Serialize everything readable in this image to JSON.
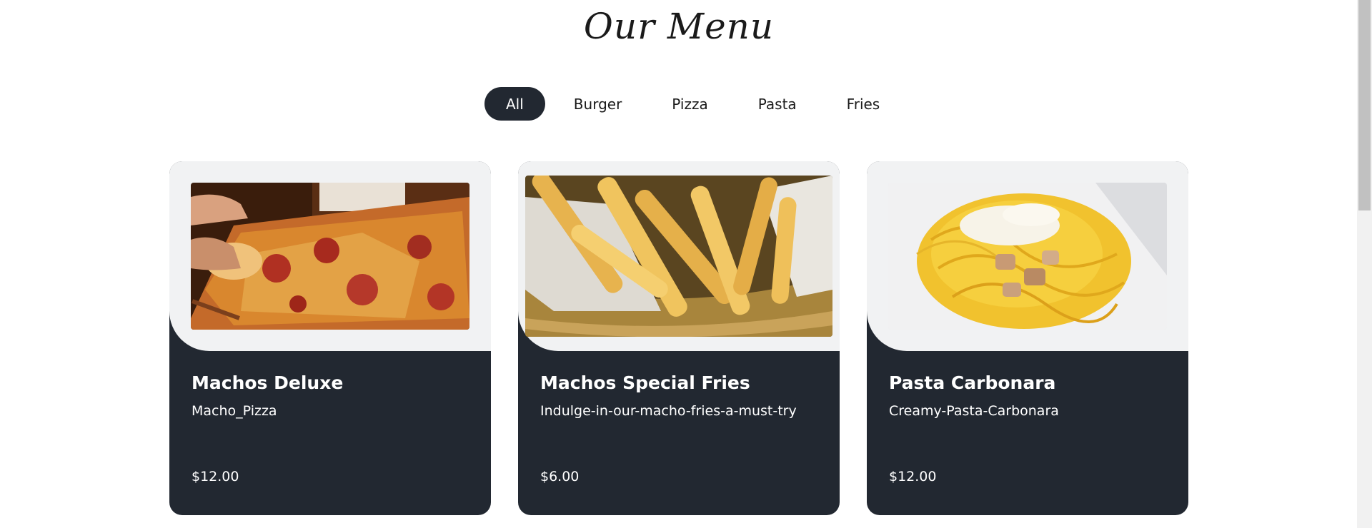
{
  "menu": {
    "title": "Our Menu",
    "filters": [
      {
        "label": "All",
        "active": true
      },
      {
        "label": "Burger",
        "active": false
      },
      {
        "label": "Pizza",
        "active": false
      },
      {
        "label": "Pasta",
        "active": false
      },
      {
        "label": "Fries",
        "active": false
      }
    ],
    "items": [
      {
        "name": "Machos Deluxe",
        "description": "Macho_Pizza",
        "price": "$12.00",
        "image": "pizza-photo"
      },
      {
        "name": "Machos Special Fries",
        "description": "Indulge-in-our-macho-fries-a-must-try",
        "price": "$6.00",
        "image": "fries-photo"
      },
      {
        "name": "Pasta Carbonara",
        "description": "Creamy-Pasta-Carbonara",
        "price": "$12.00",
        "image": "pasta-photo"
      }
    ]
  },
  "colors": {
    "dark": "#222831",
    "card_top": "#f1f2f3",
    "background": "#ffffff"
  }
}
